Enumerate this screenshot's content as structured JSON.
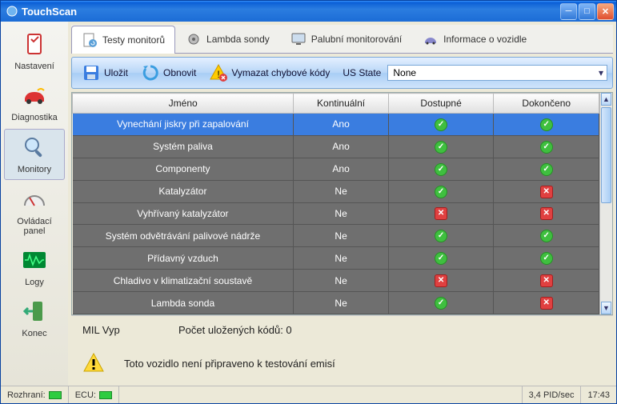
{
  "window": {
    "title": "TouchScan"
  },
  "sidebar": {
    "items": [
      {
        "label": "Nastavení"
      },
      {
        "label": "Diagnostika"
      },
      {
        "label": "Monitory"
      },
      {
        "label": "Ovládací panel"
      },
      {
        "label": "Logy"
      },
      {
        "label": "Konec"
      }
    ],
    "activeIndex": 2
  },
  "tabs": {
    "items": [
      {
        "label": "Testy monitorů"
      },
      {
        "label": "Lambda sondy"
      },
      {
        "label": "Palubní monitorování"
      },
      {
        "label": "Informace o vozidle"
      }
    ],
    "activeIndex": 0
  },
  "toolbar": {
    "save": "Uložit",
    "refresh": "Obnovit",
    "clear": "Vymazat chybové kódy",
    "usStateLabel": "US State",
    "usStateValue": "None"
  },
  "grid": {
    "headers": {
      "name": "Jméno",
      "cont": "Kontinuální",
      "avail": "Dostupné",
      "done": "Dokončeno"
    },
    "yes": "Ano",
    "no": "Ne",
    "rows": [
      {
        "name": "Vynechání jiskry při zapalování",
        "cont": "Ano",
        "avail": "ok",
        "done": "ok",
        "selected": true
      },
      {
        "name": "Systém paliva",
        "cont": "Ano",
        "avail": "ok",
        "done": "ok"
      },
      {
        "name": "Componenty",
        "cont": "Ano",
        "avail": "ok",
        "done": "ok"
      },
      {
        "name": "Katalyzátor",
        "cont": "Ne",
        "avail": "ok",
        "done": "bad"
      },
      {
        "name": "Vyhřívaný katalyzátor",
        "cont": "Ne",
        "avail": "bad",
        "done": "bad"
      },
      {
        "name": "Systém odvětrávání palivové nádrže",
        "cont": "Ne",
        "avail": "ok",
        "done": "ok"
      },
      {
        "name": "Přídavný vzduch",
        "cont": "Ne",
        "avail": "ok",
        "done": "ok"
      },
      {
        "name": "Chladivo v klimatizační soustavě",
        "cont": "Ne",
        "avail": "bad",
        "done": "bad"
      },
      {
        "name": "Lambda sonda",
        "cont": "Ne",
        "avail": "ok",
        "done": "bad"
      }
    ]
  },
  "status": {
    "mil": "MIL Vyp",
    "codes": "Počet uložených kódů: 0",
    "warn": "Toto vozidlo není připraveno k testování emisí"
  },
  "statusbar": {
    "iface": "Rozhraní:",
    "ecu": "ECU:",
    "pid": "3,4 PID/sec",
    "time": "17:43"
  },
  "icons": {
    "check": "✓",
    "cross": "✕"
  }
}
